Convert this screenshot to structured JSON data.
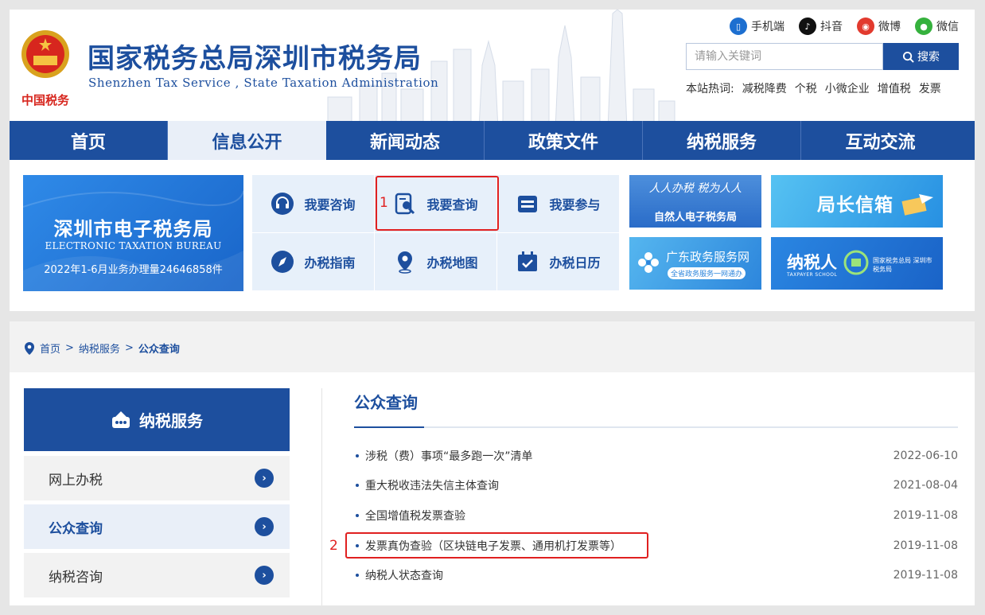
{
  "header": {
    "title": "国家税务总局深圳市税务局",
    "subtitle": "Shenzhen Tax Service , State Taxation Administration",
    "emblem_text": "中国税务",
    "social": [
      {
        "label": "手机端",
        "icon": "mobile-icon",
        "color": "#1d6fd0"
      },
      {
        "label": "抖音",
        "icon": "douyin-icon",
        "color": "#111111"
      },
      {
        "label": "微博",
        "icon": "weibo-icon",
        "color": "#e23a2e"
      },
      {
        "label": "微信",
        "icon": "wechat-icon",
        "color": "#35b13d"
      }
    ],
    "search": {
      "placeholder": "请输入关键词",
      "button": "搜索"
    },
    "hotwords": {
      "label": "本站热词:",
      "items": [
        "减税降费",
        "个税",
        "小微企业",
        "增值税",
        "发票"
      ]
    }
  },
  "nav": [
    "首页",
    "信息公开",
    "新闻动态",
    "政策文件",
    "纳税服务",
    "互动交流"
  ],
  "nav_active": 1,
  "etax": {
    "title": "深圳市电子税务局",
    "subtitle": "ELECTRONIC TAXATION BUREAU",
    "stat": "2022年1-6月业务办理量24646858件"
  },
  "quick_links": [
    {
      "label": "我要咨询",
      "icon": "headset-icon"
    },
    {
      "label": "我要查询",
      "icon": "search-document-icon"
    },
    {
      "label": "我要参与",
      "icon": "participate-icon"
    },
    {
      "label": "办税指南",
      "icon": "compass-icon"
    },
    {
      "label": "办税地图",
      "icon": "map-pin-icon"
    },
    {
      "label": "办税日历",
      "icon": "calendar-icon"
    }
  ],
  "banners": {
    "natural_person_slogan": "人人办税 税为人人",
    "natural_person_label": "自然人电子税务局",
    "director_mailbox": "局长信箱",
    "gd_gov_service": "广东政务服务网",
    "gd_gov_service_sub": "全省政务服务一网通办",
    "taxpayer_school": "纳税人",
    "taxpayer_school_en": "TAXPAYER SCHOOL",
    "taxpayer_school_org": "国家税务总局 深圳市税务局"
  },
  "annotations": {
    "mark1": "1",
    "mark2": "2"
  },
  "breadcrumb": {
    "home": "首页",
    "sep": ">",
    "section": "纳税服务",
    "current": "公众查询"
  },
  "sidebar": {
    "title": "纳税服务",
    "items": [
      {
        "label": "网上办税",
        "active": false
      },
      {
        "label": "公众查询",
        "active": true
      },
      {
        "label": "纳税咨询",
        "active": false
      }
    ]
  },
  "list": {
    "title": "公众查询",
    "items": [
      {
        "text": "涉税（费）事项“最多跑一次”清单",
        "date": "2022-06-10"
      },
      {
        "text": "重大税收违法失信主体查询",
        "date": "2021-08-04"
      },
      {
        "text": "全国增值税发票查验",
        "date": "2019-11-08"
      },
      {
        "text": "发票真伪查验（区块链电子发票、通用机打发票等）",
        "date": "2019-11-08"
      },
      {
        "text": "纳税人状态查询",
        "date": "2019-11-08"
      }
    ]
  },
  "colors": {
    "brand": "#1d4f9e",
    "annotation": "#e02020"
  }
}
